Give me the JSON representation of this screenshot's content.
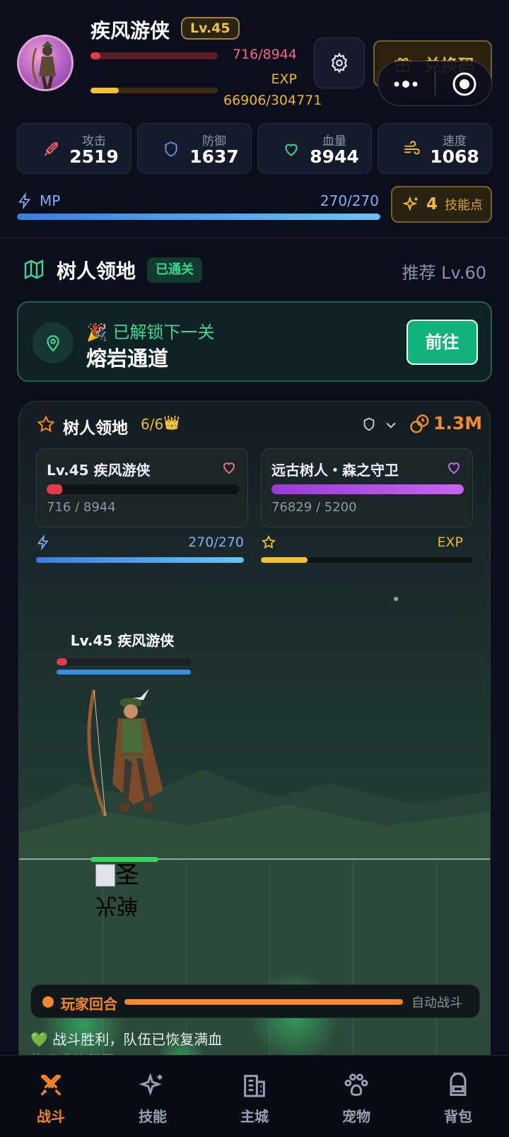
{
  "player": {
    "name": "疾风游侠",
    "level": "Lv.45",
    "hp": "716/8944",
    "hp_fraction": 0.08,
    "exp_label": "EXP",
    "exp": "66906/304771",
    "exp_fraction": 0.22
  },
  "header": {
    "redeem_label": "兑换码",
    "settings_icon": "gear-icon"
  },
  "stats": [
    {
      "label": "攻击",
      "value": "2519",
      "icon": "sword-icon",
      "color": "#f0606e"
    },
    {
      "label": "防御",
      "value": "1637",
      "icon": "shield-icon",
      "color": "#5f8fe8"
    },
    {
      "label": "血量",
      "value": "8944",
      "icon": "heart-icon",
      "color": "#3ed994"
    },
    {
      "label": "速度",
      "value": "1068",
      "icon": "wind-icon",
      "color": "#f2b93a"
    }
  ],
  "mp": {
    "label": "MP",
    "value": "270/270",
    "fraction": 1.0
  },
  "skill_points": {
    "count": "4",
    "label": "技能点"
  },
  "area": {
    "name": "树人领地",
    "badge": "已通关",
    "recommend": "推荐 Lv.60"
  },
  "unlock": {
    "label": "🎉 已解锁下一关",
    "next": "熔岩通道",
    "go": "前往"
  },
  "battle": {
    "title": "树人领地",
    "progress": "6/6",
    "gold": "1.3M",
    "player_panel": {
      "name": "Lv.45 疾风游侠",
      "hp": "716 / 8944",
      "hp_fraction": 0.08
    },
    "enemy_panel": {
      "name": "远古树人・森之守卫",
      "hp": "76829 / 5200",
      "hp_fraction": 1.0
    },
    "mp_value": "270/270",
    "exp_label": "EXP",
    "exp_fraction": 0.22,
    "hero_label": "Lv.45 疾风游侠",
    "broken_img_text": "圣",
    "broken_img_text2": "光弹",
    "turn_label": "玩家回合",
    "auto_label": "自动战斗",
    "log": [
      "💚 战斗胜利，队伍已恢复满血",
      "治疗术恢复了……"
    ]
  },
  "nav": [
    {
      "label": "战斗",
      "icon": "crossed-swords-icon",
      "active": true
    },
    {
      "label": "技能",
      "icon": "sparkles-icon",
      "active": false
    },
    {
      "label": "主城",
      "icon": "buildings-icon",
      "active": false
    },
    {
      "label": "宠物",
      "icon": "paw-icon",
      "active": false
    },
    {
      "label": "背包",
      "icon": "backpack-icon",
      "active": false
    }
  ],
  "colors": {
    "accent_orange": "#f5822a",
    "gold": "#f2b93a",
    "green": "#12b37a",
    "hp_red": "#e83a4a",
    "mp_blue": "#4a9ae8",
    "enemy_purple": "#b04ae0"
  }
}
